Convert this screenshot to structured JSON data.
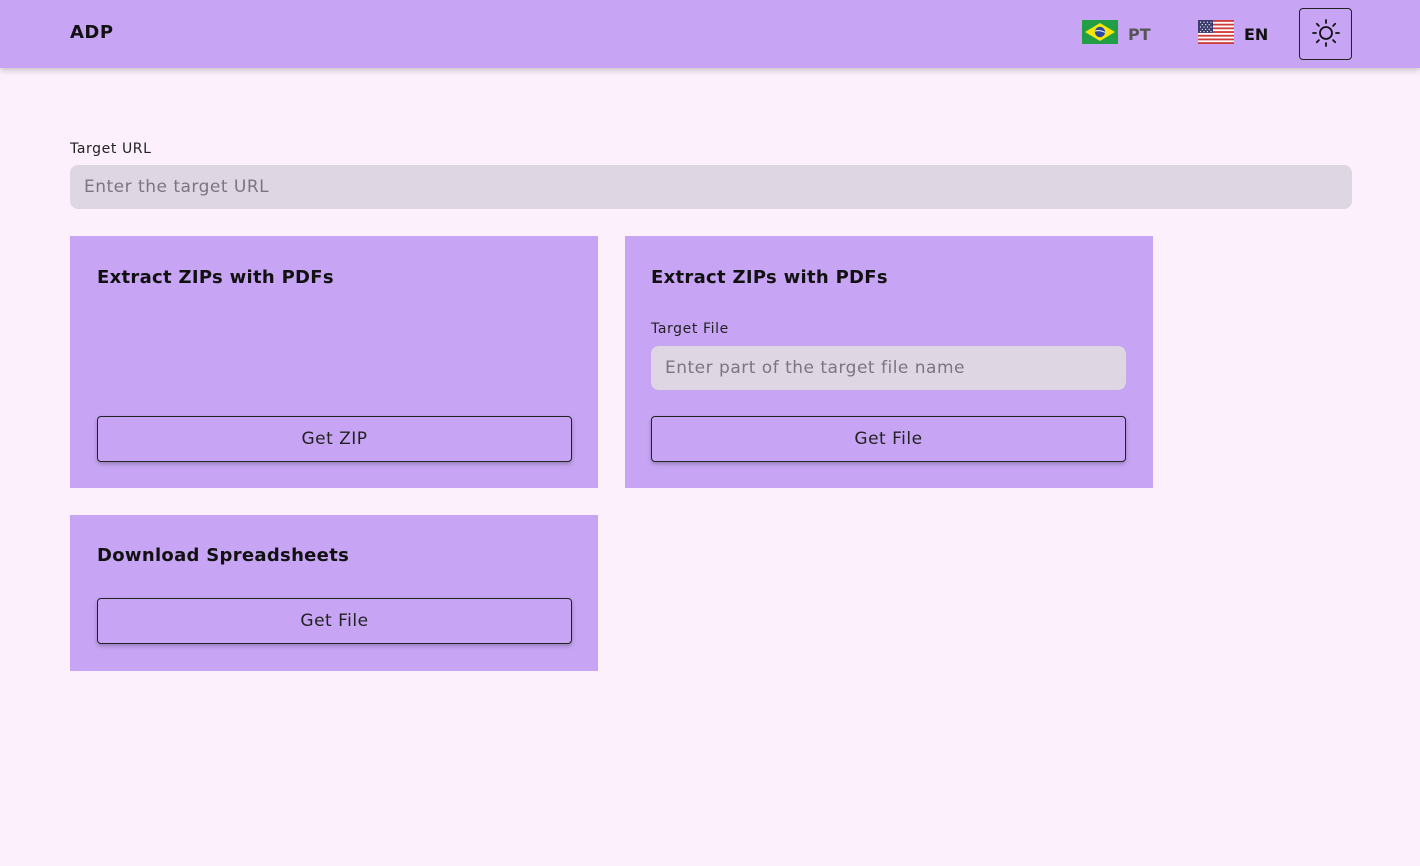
{
  "header": {
    "brand": "ADP",
    "languages": [
      {
        "code": "PT",
        "flag": "brazil-flag-icon"
      },
      {
        "code": "EN",
        "flag": "usa-flag-icon"
      }
    ],
    "theme_icon": "sun-icon"
  },
  "target_url": {
    "label": "Target URL",
    "placeholder": "Enter the target URL",
    "value": ""
  },
  "cards": [
    {
      "title": "Extract ZIPs with PDFs",
      "button_label": "Get ZIP"
    },
    {
      "title": "Extract ZIPs with PDFs",
      "field_label": "Target File",
      "field_placeholder": "Enter part of the target file name",
      "field_value": "",
      "button_label": "Get File"
    },
    {
      "title": "Download Spreadsheets",
      "button_label": "Get File"
    }
  ],
  "colors": {
    "header_bg": "#c7a5f4",
    "page_bg": "#fcf0fd",
    "card_bg": "#c7a5f4",
    "input_bg": "#ded6e3"
  }
}
